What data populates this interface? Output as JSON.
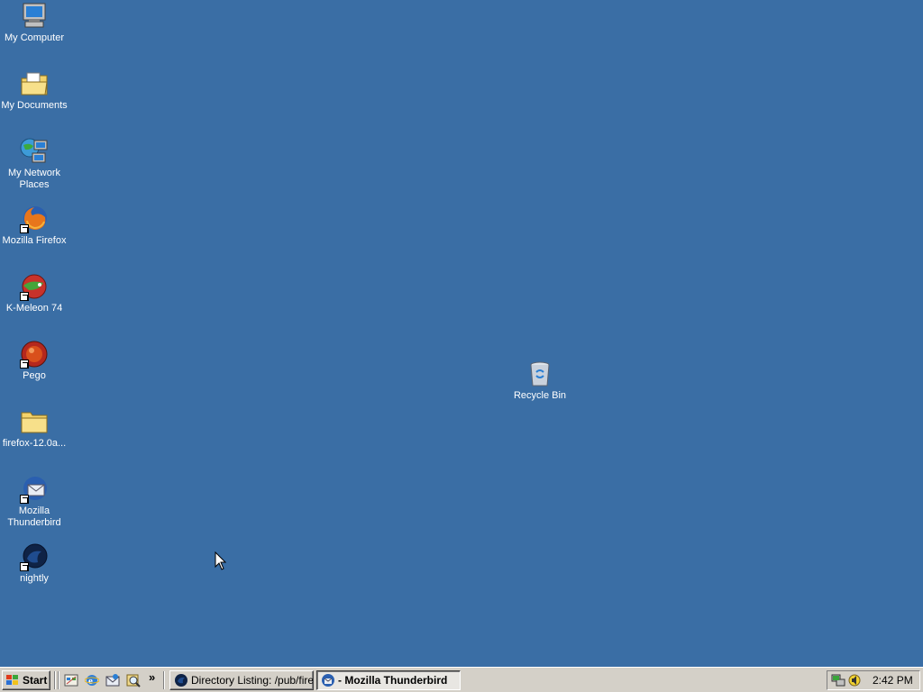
{
  "desktop": {
    "background": "#3a6ea5",
    "icons": [
      {
        "label": "My Computer",
        "icon": "my-computer-icon"
      },
      {
        "label": "My Documents",
        "icon": "my-documents-icon"
      },
      {
        "label": "My Network Places",
        "icon": "network-places-icon"
      },
      {
        "label": "Mozilla Firefox",
        "icon": "firefox-icon"
      },
      {
        "label": "K-Meleon 74",
        "icon": "k-meleon-icon"
      },
      {
        "label": "Pego",
        "icon": "pego-icon"
      },
      {
        "label": "firefox-12.0a...",
        "icon": "folder-icon"
      },
      {
        "label": "Mozilla Thunderbird",
        "icon": "thunderbird-icon"
      },
      {
        "label": "nightly",
        "icon": "nightly-icon"
      },
      {
        "label": "Recycle Bin",
        "icon": "recycle-bin-icon"
      }
    ]
  },
  "taskbar": {
    "start_label": "Start",
    "quicklaunch": [
      "show-desktop-icon",
      "internet-explorer-icon",
      "outlook-express-icon",
      "search-icon"
    ],
    "overflow_label": "»",
    "tasks": [
      {
        "label": "Directory Listing: /pub/firef...",
        "icon": "nightly-icon",
        "active": false
      },
      {
        "label": "- Mozilla Thunderbird",
        "icon": "thunderbird-icon",
        "active": true
      }
    ],
    "tray_icons": [
      "network-icon",
      "volume-icon"
    ],
    "clock": "2:42 PM"
  }
}
